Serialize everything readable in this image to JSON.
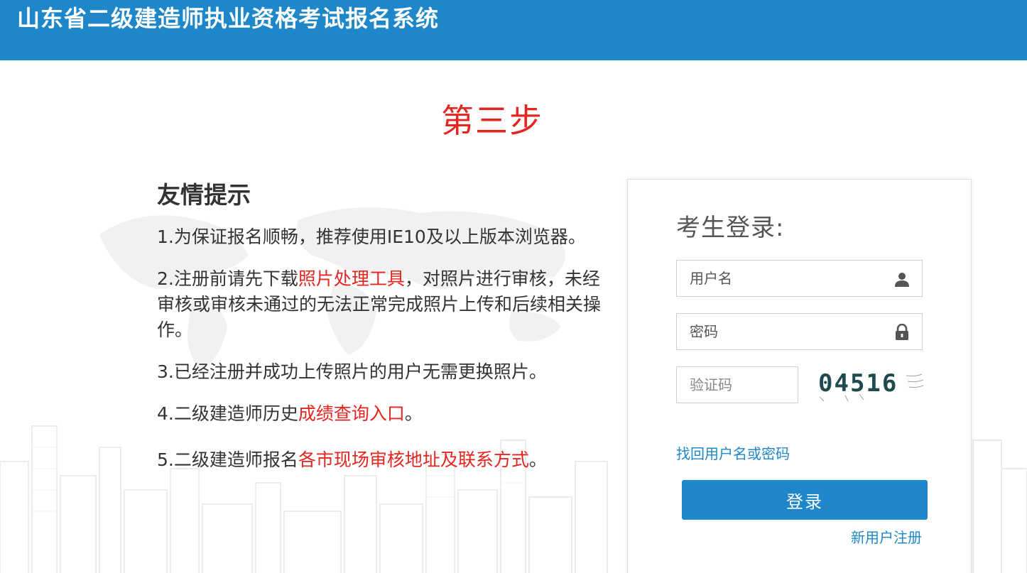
{
  "header": {
    "title": "山东省二级建造师执业资格考试报名系统"
  },
  "step": {
    "title": "第三步"
  },
  "tips": {
    "title": "友情提示",
    "item1": {
      "text": "1.为保证报名顺畅，推荐使用IE10及以上版本浏览器。"
    },
    "item2": {
      "prefix": "2.注册前请先下载",
      "link": "照片处理工具",
      "suffix": "，对照片进行审核，未经审核或审核未通过的无法正常完成照片上传和后续相关操作。"
    },
    "item3": {
      "text": "3.已经注册并成功上传照片的用户无需更换照片。"
    },
    "item4": {
      "prefix": "4.二级建造师历史",
      "link": "成绩查询入口",
      "suffix": "。"
    },
    "item5": {
      "prefix": "5.二级建造师报名",
      "link": "各市现场审核地址及联系方式",
      "suffix": "。"
    }
  },
  "login": {
    "title": "考生登录:",
    "username_placeholder": "用户名",
    "password_placeholder": "密码",
    "captcha_placeholder": "验证码",
    "captcha_text": "04516",
    "forgot_link": "找回用户名或密码",
    "login_button": "登录",
    "register_link": "新用户注册"
  },
  "colors": {
    "header_bg": "#1d87c9",
    "accent_red": "#e5251f",
    "link_blue": "#1d87c9"
  }
}
